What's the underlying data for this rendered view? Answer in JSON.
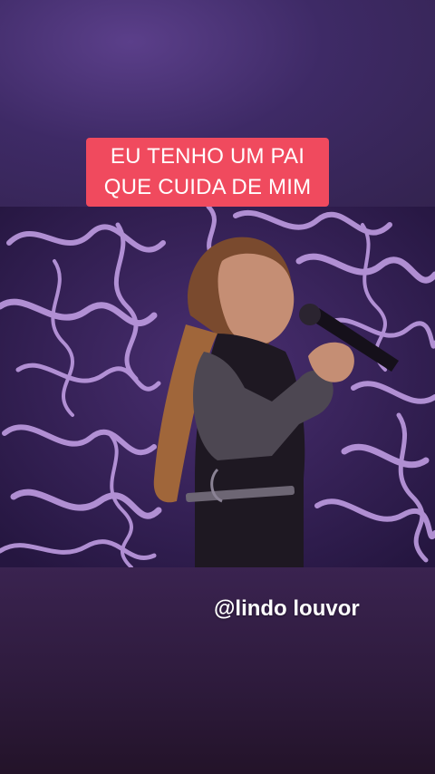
{
  "caption": {
    "line1": "EU TENHO UM PAI",
    "line2": "QUE CUIDA DE MIM"
  },
  "handle": "@lindo louvor",
  "colors": {
    "caption_bg": "#f04a5e",
    "background": "#3a2556",
    "video_lights": "#b98fe0"
  }
}
